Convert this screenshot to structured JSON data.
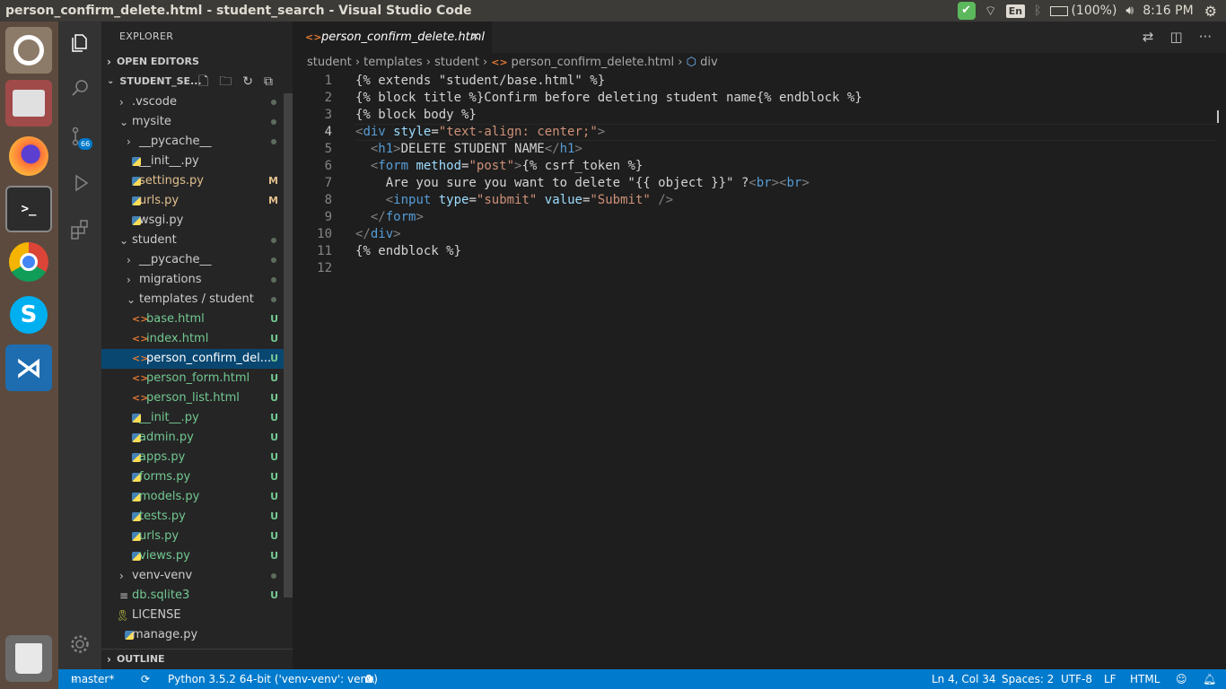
{
  "window": {
    "title": "person_confirm_delete.html - student_search - Visual Studio Code"
  },
  "tray": {
    "lang": "En",
    "battery": "(100%)",
    "time": "8:16 PM"
  },
  "launcher": [
    "dash-icon",
    "files-icon",
    "firefox-icon",
    "terminal-icon",
    "chrome-icon",
    "skype-icon",
    "vscode-icon",
    "trash-icon"
  ],
  "activity": {
    "scm_badge": "66"
  },
  "explorer": {
    "title": "EXPLORER",
    "open_editors": "OPEN EDITORS",
    "project": "STUDENT_SE...",
    "outline": "OUTLINE",
    "items": [
      {
        "label": ".vscode",
        "status": "",
        "kind": "folder"
      },
      {
        "label": "mysite",
        "status": "",
        "kind": "folder-open"
      },
      {
        "label": "__pycache__",
        "status": "",
        "kind": "folder"
      },
      {
        "label": "__init__.py",
        "status": "",
        "kind": "py"
      },
      {
        "label": "settings.py",
        "status": "M",
        "kind": "py"
      },
      {
        "label": "urls.py",
        "status": "M",
        "kind": "py"
      },
      {
        "label": "wsgi.py",
        "status": "",
        "kind": "py"
      },
      {
        "label": "student",
        "status": "",
        "kind": "folder-open"
      },
      {
        "label": "__pycache__",
        "status": "",
        "kind": "folder"
      },
      {
        "label": "migrations",
        "status": "",
        "kind": "folder"
      },
      {
        "label": "templates / student",
        "status": "",
        "kind": "folder-open"
      },
      {
        "label": "base.html",
        "status": "U",
        "kind": "html"
      },
      {
        "label": "index.html",
        "status": "U",
        "kind": "html"
      },
      {
        "label": "person_confirm_del...",
        "status": "U",
        "kind": "html"
      },
      {
        "label": "person_form.html",
        "status": "U",
        "kind": "html"
      },
      {
        "label": "person_list.html",
        "status": "U",
        "kind": "html"
      },
      {
        "label": "__init__.py",
        "status": "U",
        "kind": "py"
      },
      {
        "label": "admin.py",
        "status": "U",
        "kind": "py"
      },
      {
        "label": "apps.py",
        "status": "U",
        "kind": "py"
      },
      {
        "label": "forms.py",
        "status": "U",
        "kind": "py"
      },
      {
        "label": "models.py",
        "status": "U",
        "kind": "py"
      },
      {
        "label": "tests.py",
        "status": "U",
        "kind": "py"
      },
      {
        "label": "urls.py",
        "status": "U",
        "kind": "py"
      },
      {
        "label": "views.py",
        "status": "U",
        "kind": "py"
      },
      {
        "label": "venv-venv",
        "status": "",
        "kind": "folder"
      },
      {
        "label": "db.sqlite3",
        "status": "U",
        "kind": "db"
      },
      {
        "label": "LICENSE",
        "status": "",
        "kind": "license"
      },
      {
        "label": "manage.py",
        "status": "",
        "kind": "py"
      }
    ]
  },
  "editor": {
    "tab": "person_confirm_delete.html",
    "breadcrumb": [
      "student",
      "templates",
      "student",
      "person_confirm_delete.html",
      "div"
    ],
    "lines": [
      [
        [
          "t",
          "{% extends \"student/base.html\" %}"
        ]
      ],
      [
        [
          "t",
          "{% block title %}Confirm before deleting student name{% endblock %}"
        ]
      ],
      [
        [
          "t",
          "{% block body %}"
        ]
      ],
      [
        [
          "g",
          "<"
        ],
        [
          "n",
          "div"
        ],
        [
          "t",
          " "
        ],
        [
          "a",
          "style"
        ],
        [
          "t",
          "="
        ],
        [
          "s",
          "\"text-align: center;\""
        ],
        [
          "g",
          ">"
        ]
      ],
      [
        [
          "t",
          "  "
        ],
        [
          "g",
          "<"
        ],
        [
          "n",
          "h1"
        ],
        [
          "g",
          ">"
        ],
        [
          "t",
          "DELETE STUDENT NAME"
        ],
        [
          "g",
          "</"
        ],
        [
          "n",
          "h1"
        ],
        [
          "g",
          ">"
        ]
      ],
      [
        [
          "t",
          "  "
        ],
        [
          "g",
          "<"
        ],
        [
          "n",
          "form"
        ],
        [
          "t",
          " "
        ],
        [
          "a",
          "method"
        ],
        [
          "t",
          "="
        ],
        [
          "s",
          "\"post\""
        ],
        [
          "g",
          ">"
        ],
        [
          "t",
          "{% csrf_token %}"
        ]
      ],
      [
        [
          "t",
          "    Are you sure you want to delete \"{{ object }}\" ?"
        ],
        [
          "g",
          "<"
        ],
        [
          "n",
          "br"
        ],
        [
          "g",
          "><"
        ],
        [
          "n",
          "br"
        ],
        [
          "g",
          ">"
        ]
      ],
      [
        [
          "t",
          "    "
        ],
        [
          "g",
          "<"
        ],
        [
          "n",
          "input"
        ],
        [
          "t",
          " "
        ],
        [
          "a",
          "type"
        ],
        [
          "t",
          "="
        ],
        [
          "s",
          "\"submit\""
        ],
        [
          "t",
          " "
        ],
        [
          "a",
          "value"
        ],
        [
          "t",
          "="
        ],
        [
          "s",
          "\"Submit\""
        ],
        [
          "t",
          " "
        ],
        [
          "g",
          "/>"
        ]
      ],
      [
        [
          "t",
          "  "
        ],
        [
          "g",
          "</"
        ],
        [
          "n",
          "form"
        ],
        [
          "g",
          ">"
        ]
      ],
      [
        [
          "g",
          "</"
        ],
        [
          "n",
          "div"
        ],
        [
          "g",
          ">"
        ]
      ],
      [
        [
          "t",
          "{% endblock %}"
        ]
      ],
      [
        [
          "t",
          ""
        ]
      ]
    ]
  },
  "status": {
    "branch": "master*",
    "python": "Python 3.5.2 64-bit ('venv-venv': venv)",
    "errors": "0",
    "warnings": "0",
    "position": "Ln 4, Col 34",
    "spaces": "Spaces: 2",
    "encoding": "UTF-8",
    "eol": "LF",
    "language": "HTML"
  }
}
